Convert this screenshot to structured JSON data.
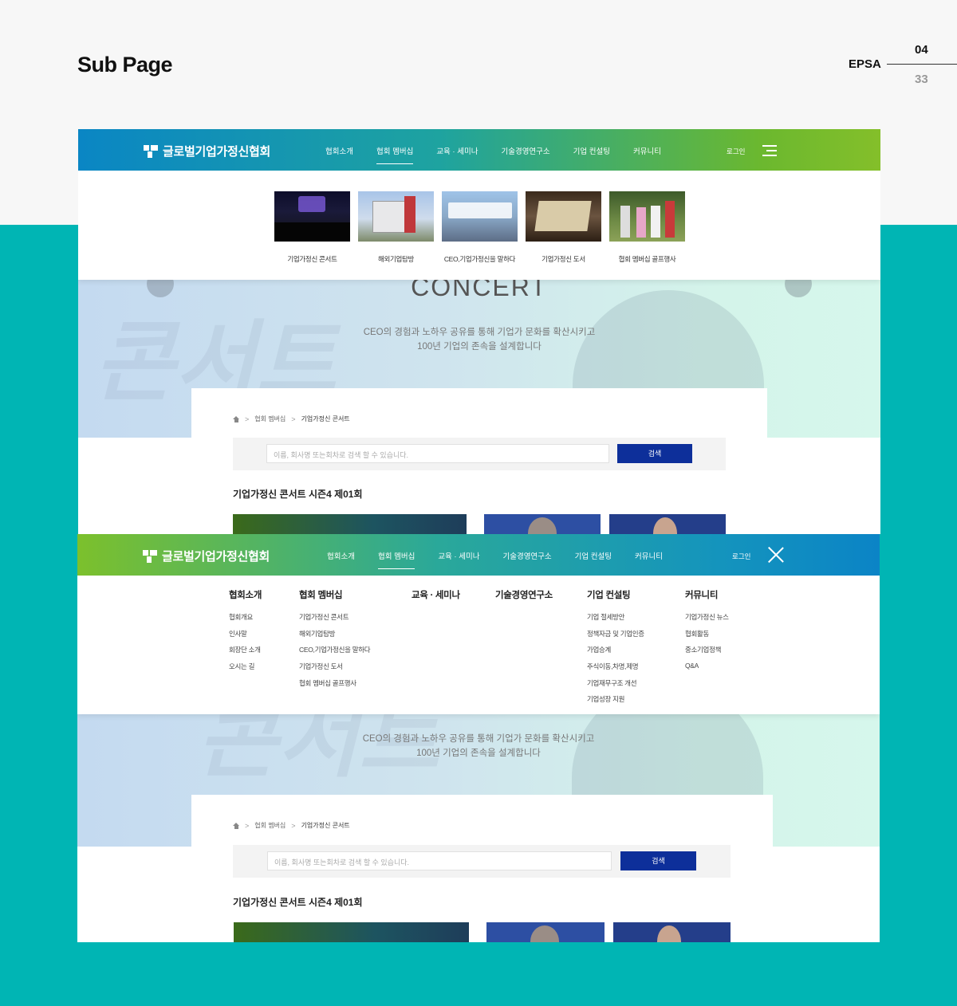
{
  "header": {
    "title": "Sub Page",
    "brand": "EPSA",
    "page_current": "04",
    "page_total": "33"
  },
  "site": {
    "logo_text": "글로벌기업가정신협회",
    "menu": [
      "협회소개",
      "협회 멤버십",
      "교육 · 세미나",
      "기술경영연구소",
      "기업 컨설팅",
      "커뮤니티"
    ],
    "login": "로그인"
  },
  "membership_submenu": [
    {
      "label": "기업가정신 콘서트"
    },
    {
      "label": "해외기업탐방"
    },
    {
      "label": "CEO,기업가정신을 말하다"
    },
    {
      "label": "기업가정신 도서"
    },
    {
      "label": "협회 멤버십 골프행사"
    }
  ],
  "hero": {
    "title": "CONCERT",
    "tagline_1": "CEO의 경험과 노하우 공유를 통해 기업가 문화를 확산시키고",
    "tagline_2": "100년 기업의 존속을 설계합니다"
  },
  "breadcrumb": {
    "level1": "협회 멤버십",
    "level2": "기업가정신 콘서트"
  },
  "search": {
    "placeholder": "이름, 회사명 또는회차로 검색 할 수 있습니다.",
    "button": "검색"
  },
  "section_title": "기업가정신 콘서트 시즌4 제01회",
  "mega_menu": [
    {
      "heading": "협회소개",
      "items": [
        "협회개요",
        "인사말",
        "회장단 소개",
        "오시는 길"
      ]
    },
    {
      "heading": "협회 멤버십",
      "items": [
        "기업가정신 콘서트",
        "해외기업탐방",
        "CEO,기업가정신을 말하다",
        "기업가정신 도서",
        "협회 멤버십 골프행사"
      ]
    },
    {
      "heading": "교육 · 세미나",
      "items": []
    },
    {
      "heading": "기술경영연구소",
      "items": []
    },
    {
      "heading": "기업 컨설팅",
      "items": [
        "기업 절세방안",
        "정책자금 및 기업인증",
        "가업승계",
        "주식이동,차명,제명",
        "기업재무구조 개선",
        "기업성장 지원"
      ]
    },
    {
      "heading": "커뮤니티",
      "items": [
        "기업가정신 뉴스",
        "협회활동",
        "중소기업정책",
        "Q&A"
      ]
    }
  ],
  "colors": {
    "teal_background": "#00b5b4",
    "search_button": "#0d2f9a",
    "nav_blue": "#0a86c4",
    "nav_green": "#84bf2a"
  },
  "icons": [
    "logo-mark",
    "hamburger-icon",
    "close-icon",
    "home-icon",
    "chevron-right-icon"
  ]
}
